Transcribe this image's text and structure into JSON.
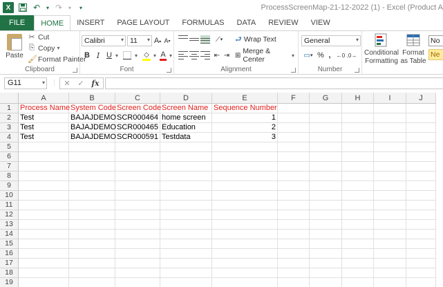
{
  "window": {
    "title": "ProcessScreenMap-21-12-2022 (1) - Excel (Product A",
    "logo": "X"
  },
  "tabs": [
    "FILE",
    "HOME",
    "INSERT",
    "PAGE LAYOUT",
    "FORMULAS",
    "DATA",
    "REVIEW",
    "VIEW"
  ],
  "active_tab": "HOME",
  "ribbon": {
    "clipboard": {
      "label": "Clipboard",
      "paste": "Paste",
      "cut": "Cut",
      "copy": "Copy",
      "format_painter": "Format Painter"
    },
    "font": {
      "label": "Font",
      "name": "Calibri",
      "size": "11",
      "grow": "A",
      "shrink": "A",
      "bold": "B",
      "italic": "I",
      "underline": "U",
      "font_color_letter": "A"
    },
    "alignment": {
      "label": "Alignment",
      "wrap_text": "Wrap Text",
      "merge_center": "Merge & Center"
    },
    "number": {
      "label": "Number",
      "format": "General",
      "percent": "%",
      "comma": ","
    },
    "styles": {
      "conditional_formatting": "Conditional Formatting",
      "format_as_table": "Format as Table",
      "normal_style": "No",
      "neutral_style": "Ne"
    }
  },
  "formula_bar": {
    "name_box": "G11",
    "fx": "fx",
    "content": ""
  },
  "sheet": {
    "columns": [
      "A",
      "B",
      "C",
      "D",
      "E",
      "F",
      "G",
      "H",
      "I",
      "J"
    ],
    "row_numbers": [
      "1",
      "2",
      "3",
      "4",
      "5",
      "6",
      "7",
      "8",
      "9",
      "10",
      "11",
      "12",
      "13",
      "14",
      "15",
      "16",
      "17",
      "18",
      "19"
    ],
    "header_row": [
      "Process Name",
      "System Code",
      "Screen Code",
      "Screen Name",
      "Sequence Number"
    ],
    "data_rows": [
      [
        "Test",
        "BAJAJDEMO",
        "SCR000464",
        "home screen",
        "1"
      ],
      [
        "Test",
        "BAJAJDEMO",
        "SCR000465",
        "Education",
        "2"
      ],
      [
        "Test",
        "BAJAJDEMO",
        "SCR000591",
        "Testdata",
        "3"
      ]
    ]
  },
  "colors": {
    "accent": "#217346",
    "header_text": "#e0201c"
  }
}
